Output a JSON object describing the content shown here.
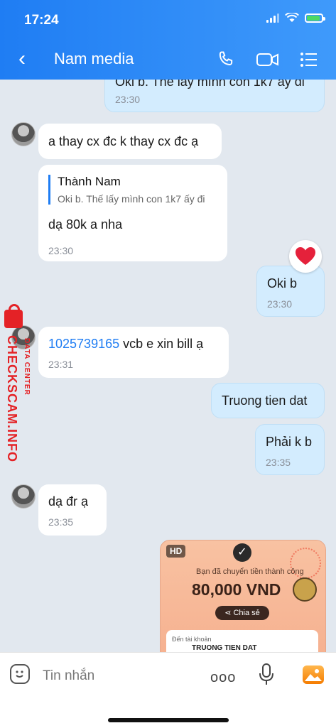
{
  "status_bar": {
    "time": "17:24"
  },
  "header": {
    "title": "Nam media"
  },
  "messages": [
    {
      "id": "m0",
      "text": "Oki b. Thế lấy mình con 1k7 ấy đi",
      "time": "23:30",
      "direction": "out"
    },
    {
      "id": "m1",
      "text": "a thay cx đc k thay cx đc ạ",
      "direction": "in"
    },
    {
      "id": "m2",
      "quote_name": "Thành Nam",
      "quote_text": "Oki b. Thế lấy mình con 1k7 ấy đi",
      "text": "dạ 80k a nha",
      "time": "23:30",
      "direction": "in"
    },
    {
      "id": "m3",
      "text": "Oki b",
      "time": "23:30",
      "direction": "out",
      "reaction": "heart"
    },
    {
      "id": "m4",
      "link": "1025739165",
      "text": " vcb e xin bill ạ",
      "time": "23:31",
      "direction": "in"
    },
    {
      "id": "m5",
      "text": "Truong tien dat",
      "direction": "out"
    },
    {
      "id": "m6",
      "text": "Phải k b",
      "time": "23:35",
      "direction": "out"
    },
    {
      "id": "m7",
      "text": "dạ đr ạ",
      "time": "23:35",
      "direction": "in"
    }
  ],
  "image_message": {
    "badge": "HD",
    "success_text": "Bạn đã chuyển tiền thành công",
    "amount": "80,000 VND",
    "share_label": "Chia sẻ",
    "account_label": "Đến tài khoản",
    "account_name": "TRUONG TIEN DAT"
  },
  "watermark": {
    "main": "CHECKSCAM.INFO",
    "sub": "DATA CENTER"
  },
  "composer": {
    "placeholder": "Tin nhắn",
    "more": "ooo"
  },
  "colors": {
    "header": "#1f7df3",
    "outgoing": "#d3ecfe",
    "link": "#1f7df3",
    "watermark": "#e42226"
  }
}
